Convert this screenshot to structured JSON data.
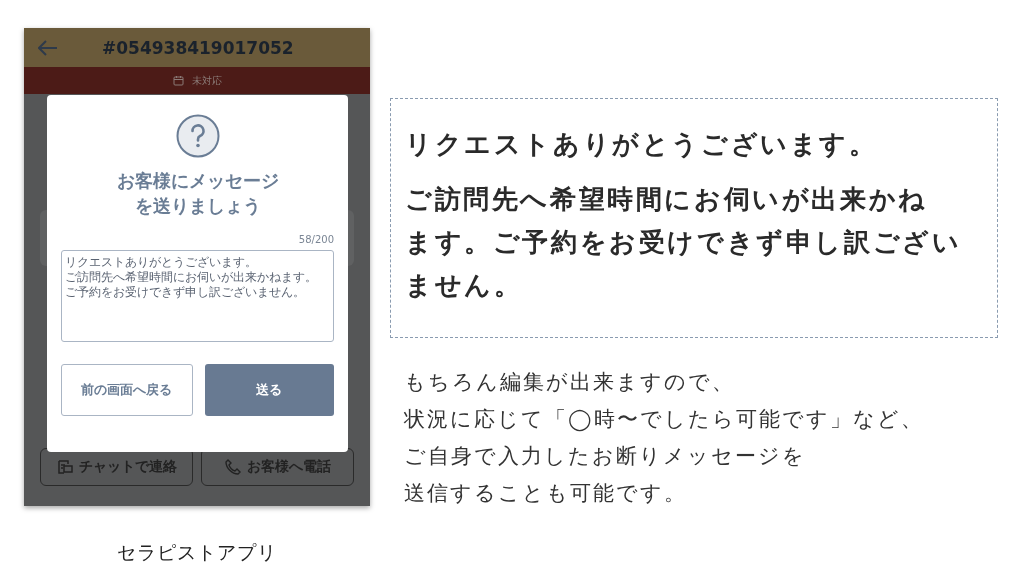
{
  "phone": {
    "order_number": "#054938419017052",
    "status": "未対応",
    "actions": [
      {
        "kind": "chat",
        "label": "チャットで連絡"
      },
      {
        "kind": "phone",
        "label": "お客様へ電話"
      }
    ],
    "dialog": {
      "title_lines": [
        "お客様にメッセージ",
        "を送りましょう"
      ],
      "counter": "58/200",
      "message_lines": [
        "リクエストありがとうございます。",
        "ご訪問先へ希望時間にお伺いが出来かねます。",
        "ご予約をお受けできず申し訳ございません。"
      ],
      "buttons": [
        {
          "kind": "secondary",
          "label": "前の画面へ戻る"
        },
        {
          "kind": "primary",
          "label": "送る"
        }
      ]
    }
  },
  "caption": "セラピストアプリ",
  "callout": {
    "lines": [
      "リクエストありがとうございます。",
      "ご訪問先へ希望時間にお伺いが出来かね",
      "ます。ご予約をお受けできず申し訳ござい",
      "ません。"
    ]
  },
  "note_lines": [
    "もちろん編集が出来ますので、",
    "状況に応じて「◯時〜でしたら可能です」など、",
    "ご自身で入力したお断りメッセージを",
    "送信することも可能です。"
  ]
}
